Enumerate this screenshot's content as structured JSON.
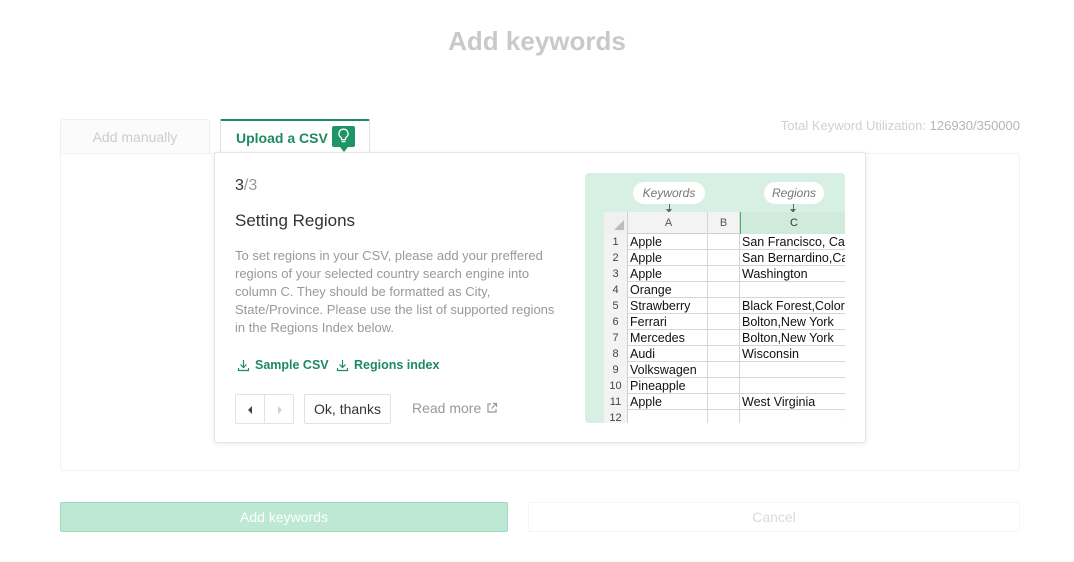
{
  "header": {
    "title": "Add keywords"
  },
  "tabs": {
    "manual": "Add manually",
    "csv": "Upload a CSV"
  },
  "utilization": {
    "label": "Total Keyword Utilization:",
    "value": "126930/350000"
  },
  "popover": {
    "step_current": "3",
    "step_total": "/3",
    "title": "Setting Regions",
    "description": "To set regions in your CSV, please add your preffered regions of your selected country search engine into column C. They should be formatted as City, State/Province. Please use the list of supported regions in the Regions Index below.",
    "sample_csv": "Sample CSV",
    "regions_index": "Regions index",
    "ok_label": "Ok, thanks",
    "read_more": "Read more"
  },
  "illustration": {
    "keywords_label": "Keywords",
    "regions_label": "Regions",
    "columns": [
      "A",
      "B",
      "C"
    ],
    "rows": [
      {
        "n": "1",
        "a": "Apple",
        "c": "San Francisco, California"
      },
      {
        "n": "2",
        "a": "Apple",
        "c": "San Bernardino,California"
      },
      {
        "n": "3",
        "a": "Apple",
        "c": "Washington"
      },
      {
        "n": "4",
        "a": "Orange",
        "c": ""
      },
      {
        "n": "5",
        "a": "Strawberry",
        "c": "Black Forest,Colorado"
      },
      {
        "n": "6",
        "a": "Ferrari",
        "c": "Bolton,New York"
      },
      {
        "n": "7",
        "a": "Mercedes",
        "c": "Bolton,New York"
      },
      {
        "n": "8",
        "a": "Audi",
        "c": "Wisconsin"
      },
      {
        "n": "9",
        "a": "Volkswagen",
        "c": ""
      },
      {
        "n": "10",
        "a": "Pineapple",
        "c": ""
      },
      {
        "n": "11",
        "a": "Apple",
        "c": "West Virginia"
      },
      {
        "n": "12",
        "a": "",
        "c": ""
      }
    ]
  },
  "footer": {
    "add_label": "Add keywords",
    "cancel_label": "Cancel"
  },
  "colors": {
    "accent": "#1e8a5f",
    "disabled_button": "#bde8d3",
    "illustration_bg": "#d8efe3"
  },
  "icons": {
    "tab_hint": "lightbulb-icon",
    "download": "download-icon",
    "external": "external-link-icon"
  }
}
